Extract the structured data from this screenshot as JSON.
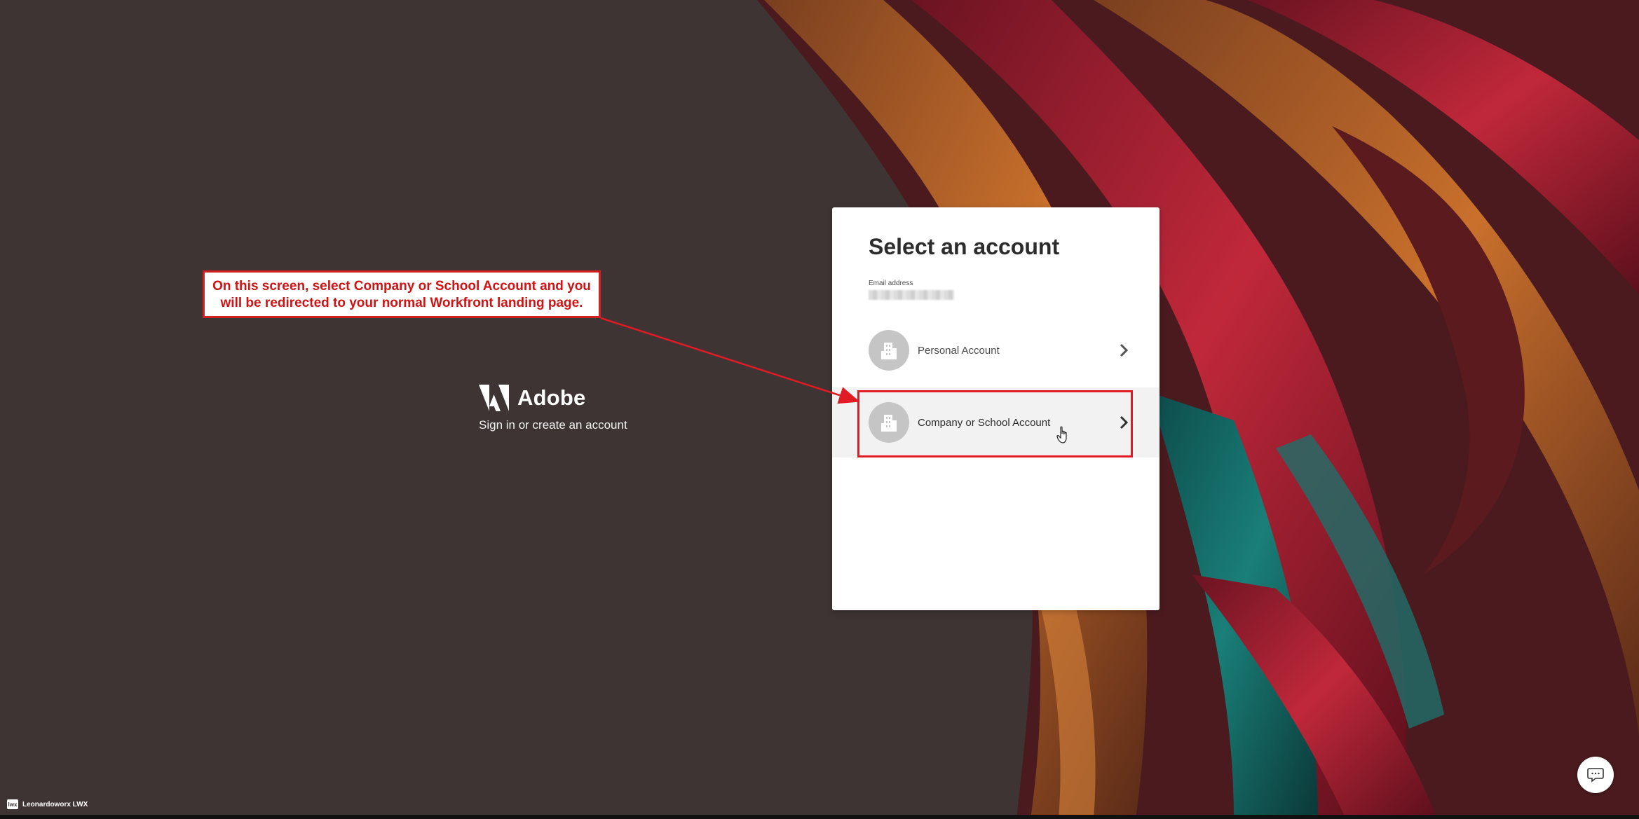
{
  "brand": {
    "name": "Adobe",
    "tagline": "Sign in or create an account"
  },
  "card": {
    "title": "Select an account",
    "email_label": "Email address",
    "accounts": [
      {
        "label": "Personal Account",
        "icon": "building-icon"
      },
      {
        "label": "Company or School Account",
        "icon": "building-icon"
      }
    ]
  },
  "annotation": {
    "text_line1": "On this screen, select Company or School Account and you",
    "text_line2": "will be redirected to your normal Workfront landing page."
  },
  "footer": {
    "label": "Leonardoworx LWX",
    "logo_text": "lwx"
  },
  "colors": {
    "background": "#3d3433",
    "annotation_red": "#d42020",
    "card_bg": "#ffffff",
    "avatar_gray": "#c5c5c5"
  }
}
